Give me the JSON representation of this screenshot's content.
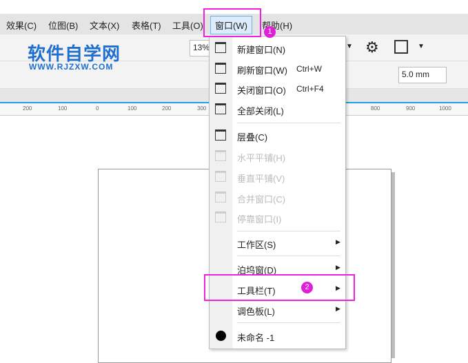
{
  "menubar": [
    "效果(C)",
    "位图(B)",
    "文本(X)",
    "表格(T)",
    "工具(O)",
    "窗口(W)",
    "帮助(H)"
  ],
  "logo": {
    "title": "软件自学网",
    "subtitle": "WWW.RJZXW.COM"
  },
  "toolbar": {
    "zoom": "13%",
    "nudge": "5.0 mm"
  },
  "ruler": [
    "200",
    "100",
    "0",
    "100",
    "200",
    "300",
    "800",
    "900",
    "1000"
  ],
  "menu": [
    {
      "label": "新建窗口(N)",
      "icon": "new-window-icon"
    },
    {
      "label": "刷新窗口(W)",
      "shortcut": "Ctrl+W",
      "icon": "refresh-window-icon"
    },
    {
      "label": "关闭窗口(O)",
      "shortcut": "Ctrl+F4",
      "icon": "close-window-icon"
    },
    {
      "label": "全部关闭(L)",
      "icon": "close-all-icon"
    },
    {
      "label": "层叠(C)",
      "icon": "cascade-icon"
    },
    {
      "label": "水平平铺(H)",
      "icon": "tile-horizontal-icon",
      "disabled": true
    },
    {
      "label": "垂直平铺(V)",
      "icon": "tile-vertical-icon",
      "disabled": true
    },
    {
      "label": "合并窗口(C)",
      "icon": "combine-icon",
      "disabled": true
    },
    {
      "label": "停靠窗口(I)",
      "icon": "dock-icon",
      "disabled": true
    },
    {
      "label": "工作区(S)"
    },
    {
      "label": "泊坞窗(D)"
    },
    {
      "label": "工具栏(T)"
    },
    {
      "label": "调色板(L)"
    },
    {
      "label": "未命名 -1"
    }
  ],
  "badges": [
    "1",
    "2"
  ],
  "colors": {
    "highlight": "#f020e0",
    "accent": "#19a0e6"
  }
}
